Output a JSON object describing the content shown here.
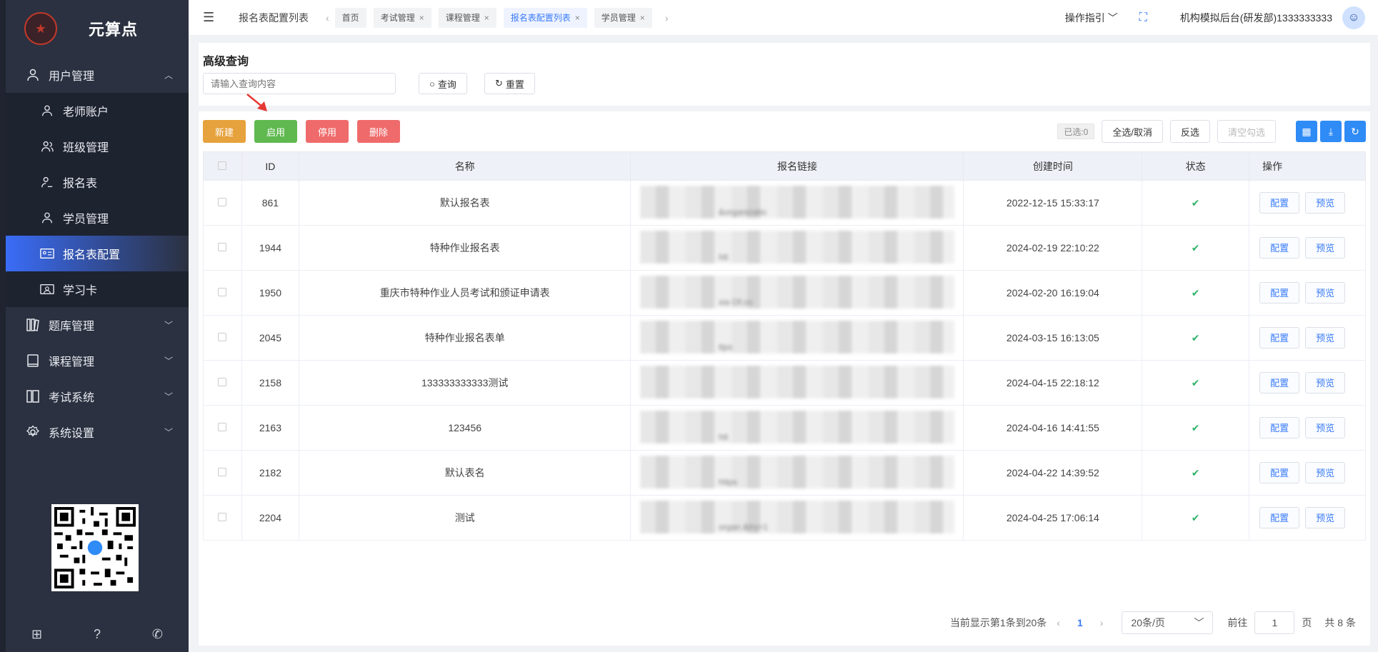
{
  "brand": {
    "name": "元算点",
    "logo_mark": "★"
  },
  "sidebar": {
    "items": [
      {
        "label": "用户管理",
        "icon": "users-icon",
        "expanded": true
      },
      {
        "label": "老师账户",
        "icon": "user-icon"
      },
      {
        "label": "班级管理",
        "icon": "group-icon"
      },
      {
        "label": "报名表",
        "icon": "user-edit-icon"
      },
      {
        "label": "学员管理",
        "icon": "user-icon"
      },
      {
        "label": "报名表配置",
        "icon": "id-card-icon",
        "active": true
      },
      {
        "label": "学习卡",
        "icon": "card-icon"
      },
      {
        "label": "题库管理",
        "icon": "library-icon"
      },
      {
        "label": "课程管理",
        "icon": "book-icon"
      },
      {
        "label": "考试系统",
        "icon": "exam-icon"
      },
      {
        "label": "系统设置",
        "icon": "gear-icon"
      }
    ]
  },
  "header": {
    "page": "报名表配置列表",
    "tabs": [
      "首页",
      "考试管理",
      "课程管理",
      "报名表配置列表",
      "学员管理"
    ],
    "close": "×",
    "guide": "操作指引",
    "user": "机构模拟后台(研发部)1333333333"
  },
  "search": {
    "title": "高级查询",
    "placeholder": "请输入查询内容",
    "query_label": "查询",
    "reset_label": "重置"
  },
  "actions": {
    "new": "新建",
    "enable": "启用",
    "disable": "停用",
    "delete": "删除",
    "selected": "已选:0",
    "select_all": "全选/取消",
    "invert": "反选",
    "clear": "清空勾选"
  },
  "table": {
    "headers": [
      "ID",
      "名称",
      "报名链接",
      "创建时间",
      "状态",
      "操作"
    ],
    "rows": [
      {
        "id": "861",
        "name": "默认报名表",
        "link_tail": "&organizatio",
        "created": "2022-12-15 15:33:17"
      },
      {
        "id": "1944",
        "name": "特种作业报名表",
        "link_tail": "htt",
        "created": "2024-02-19 22:10:22"
      },
      {
        "id": "1950",
        "name": "重庆市特种作业人员考试和颁证申请表",
        "link_tail": "xia Of.co",
        "created": "2024-02-20 16:19:04"
      },
      {
        "id": "2045",
        "name": "特种作业报名表单",
        "link_tail": "ttps",
        "created": "2024-03-15 16:13:05"
      },
      {
        "id": "2158",
        "name": "133333333333测试",
        "link_tail": "",
        "created": "2024-04-15 22:18:12"
      },
      {
        "id": "2163",
        "name": "123456",
        "link_tail": "htt",
        "created": "2024-04-16 14:41:55"
      },
      {
        "id": "2182",
        "name": "默认表名",
        "link_tail": "https",
        "created": "2024-04-22 14:39:52"
      },
      {
        "id": "2204",
        "name": "测试",
        "link_tail": "organ &try=1",
        "created": "2024-04-25 17:06:14"
      }
    ],
    "status_mark": "✔",
    "op_config": "配置",
    "op_preview": "预览"
  },
  "pager": {
    "summary": "当前显示第1条到20条",
    "page": "1",
    "size": "20条/页",
    "goto_label": "前往",
    "goto_value": "1",
    "page_unit": "页",
    "total": "共 8 条"
  },
  "colors": {
    "new": "#e6a23c",
    "enable": "#5fb94f",
    "disable": "#ef6b6b",
    "delete": "#ef6b6b",
    "accent": "#3a7bf7"
  }
}
